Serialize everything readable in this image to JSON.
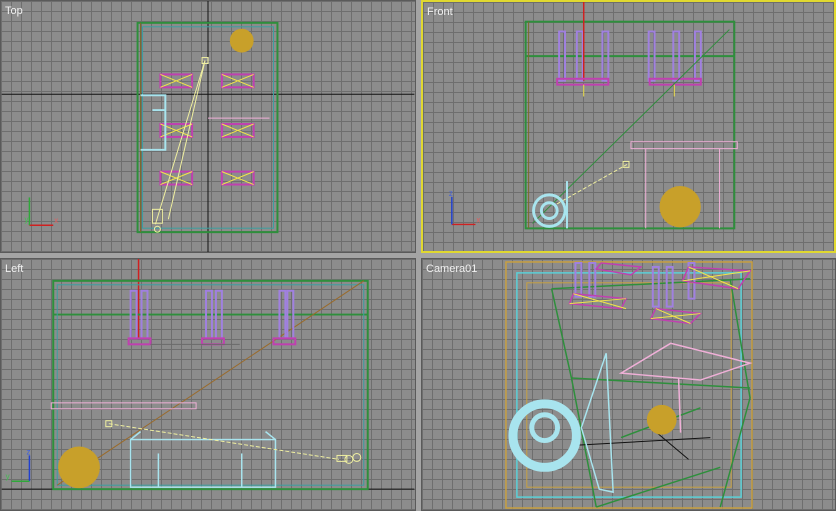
{
  "viewports": {
    "top": {
      "label": "Top"
    },
    "front": {
      "label": "Front"
    },
    "left": {
      "label": "Left"
    },
    "camera": {
      "label": "Camera01"
    }
  },
  "active_viewport": "Front",
  "gizmo": {
    "axis_x": "x",
    "axis_y": "y",
    "axis_z": "z"
  },
  "colors": {
    "viewport_bg": "#8c8c8c",
    "grid_line": "#6e6e6e",
    "active_border": "#e0d830",
    "world_axis": "#111111",
    "room_green": "#2e8f3c",
    "cyan_object": "#a8e4ee",
    "magenta_object": "#c040b0",
    "violet_object": "#a080e0",
    "yellow_light": "#f2e44a",
    "sphere_gold": "#c8a02a",
    "brown_object": "#9a6a2a",
    "camera_line": "#f0f0a0",
    "pink_table": "#f0b0d8",
    "red_axis": "#d02020"
  }
}
